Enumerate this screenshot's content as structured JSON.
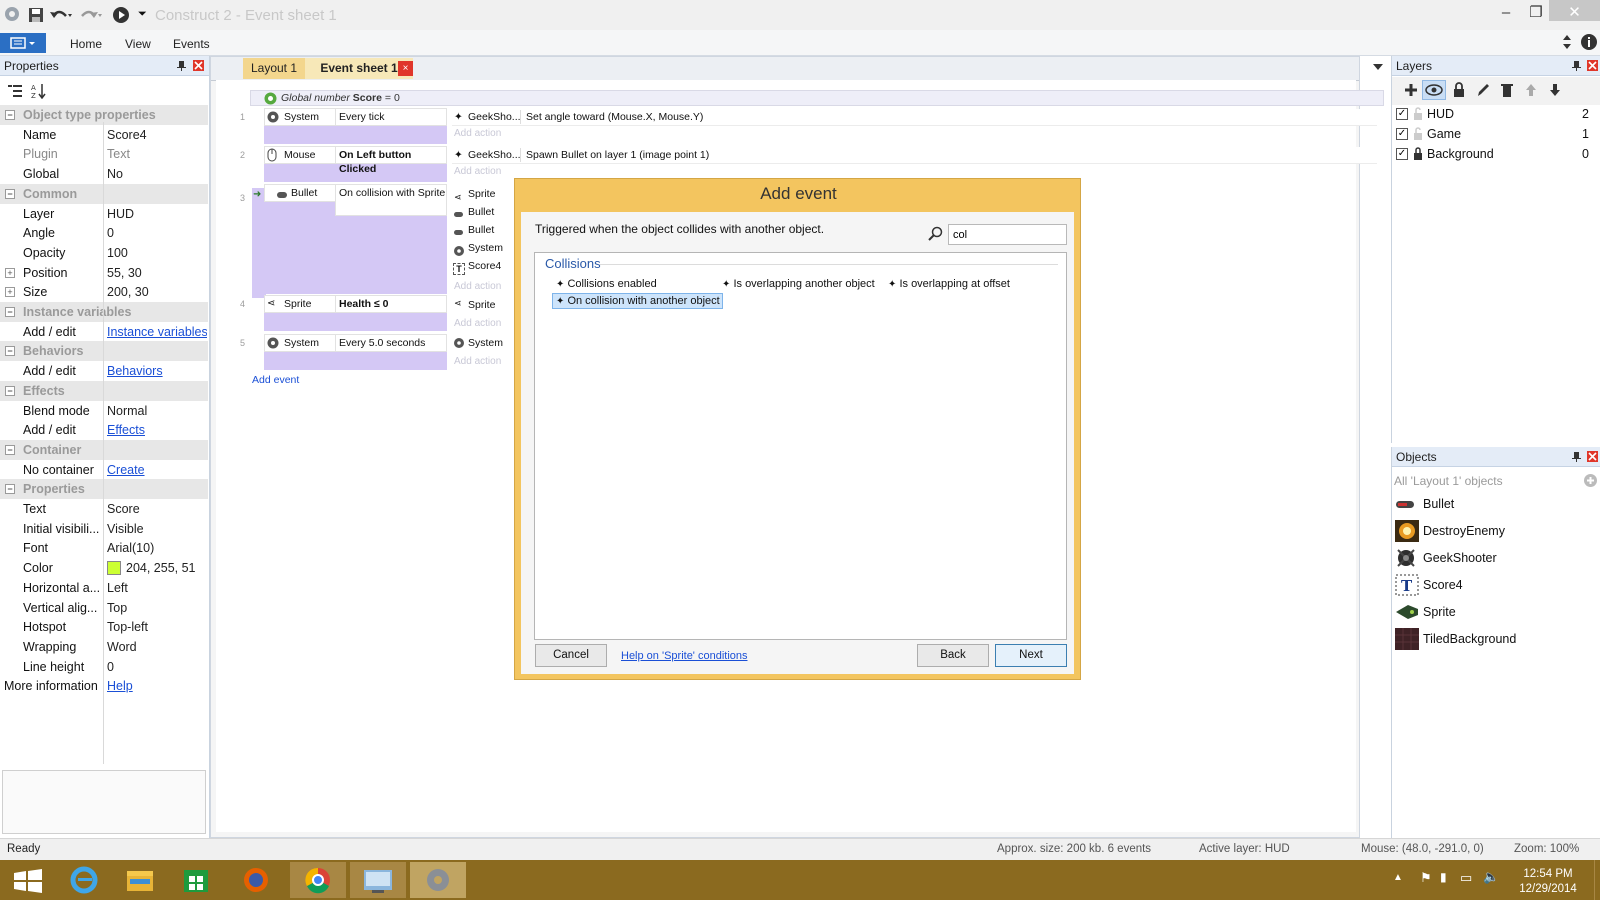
{
  "window": {
    "titlebar": {
      "title": "Construct 2 - Event sheet 1"
    },
    "ribbon_tabs": [
      "Home",
      "View",
      "Events"
    ]
  },
  "properties_panel": {
    "title": "Properties",
    "rows": [
      {
        "type": "section",
        "label": "Object type properties"
      },
      {
        "key": "Name",
        "value": "Score4"
      },
      {
        "key": "Plugin",
        "value": "Text",
        "muted": true
      },
      {
        "key": "Global",
        "value": "No"
      },
      {
        "type": "section",
        "label": "Common"
      },
      {
        "key": "Layer",
        "value": "HUD"
      },
      {
        "key": "Angle",
        "value": "0"
      },
      {
        "key": "Opacity",
        "value": "100"
      },
      {
        "key": "Position",
        "value": "55, 30",
        "expand": true
      },
      {
        "key": "Size",
        "value": "200, 30",
        "expand": true
      },
      {
        "type": "section",
        "label": "Instance variables"
      },
      {
        "key": "Add / edit",
        "link": "Instance variables"
      },
      {
        "type": "section",
        "label": "Behaviors"
      },
      {
        "key": "Add / edit",
        "link": "Behaviors"
      },
      {
        "type": "section",
        "label": "Effects"
      },
      {
        "key": "Blend mode",
        "value": "Normal"
      },
      {
        "key": "Add / edit",
        "link": "Effects"
      },
      {
        "type": "section",
        "label": "Container"
      },
      {
        "key": "No container",
        "link": "Create"
      },
      {
        "type": "section",
        "label": "Properties"
      },
      {
        "key": "Text",
        "value": "Score"
      },
      {
        "key": "Initial visibili...",
        "value": "Visible"
      },
      {
        "key": "Font",
        "value": "Arial(10)"
      },
      {
        "key": "Color",
        "value": "204, 255, 51",
        "swatch": "#ccff33"
      },
      {
        "key": "Horizontal a...",
        "value": "Left"
      },
      {
        "key": "Vertical alig...",
        "value": "Top"
      },
      {
        "key": "Hotspot",
        "value": "Top-left"
      },
      {
        "key": "Wrapping",
        "value": "Word"
      },
      {
        "key": "Line height",
        "value": "0"
      },
      {
        "key": "More information",
        "link": "Help",
        "wide": true
      }
    ]
  },
  "doc_tabs": [
    {
      "label": "Layout 1",
      "active": false
    },
    {
      "label": "Event sheet 1",
      "active": true
    }
  ],
  "event_sheet": {
    "global_var": {
      "prefix": "Global number ",
      "name": "Score",
      "suffix": " = 0"
    },
    "events": [
      {
        "num": "1",
        "object": "System",
        "condition": "Every tick",
        "actions": [
          {
            "object": "GeekSho...",
            "text": "Set angle toward (Mouse.X, Mouse.Y)"
          }
        ]
      },
      {
        "num": "2",
        "object": "Mouse",
        "condition": "On Left button Clicked",
        "actions": [
          {
            "object": "GeekSho...",
            "text": "Spawn  Bullet on layer 1 (image point 1)"
          }
        ]
      },
      {
        "num": "3",
        "object": "Bullet",
        "condition": "On collision with  Sprite",
        "actions": [
          {
            "object": "Sprite"
          },
          {
            "object": "Bullet"
          },
          {
            "object": "Bullet"
          },
          {
            "object": "System"
          },
          {
            "object": "Score4"
          }
        ]
      },
      {
        "num": "4",
        "object": "Sprite",
        "condition": "Health ≤ 0",
        "actions": [
          {
            "object": "Sprite"
          }
        ]
      },
      {
        "num": "5",
        "object": "System",
        "condition": "Every 5.0 seconds",
        "actions": [
          {
            "object": "System"
          }
        ]
      }
    ],
    "add_action": "Add action",
    "add_event": "Add event"
  },
  "dialog": {
    "title": "Add event",
    "description": "Triggered when the object collides with another object.",
    "search_value": "col",
    "group": "Collisions",
    "items": [
      {
        "label": "Collisions enabled",
        "selected": false
      },
      {
        "label": "Is overlapping another object",
        "selected": false
      },
      {
        "label": "Is overlapping at offset",
        "selected": false
      },
      {
        "label": "On collision with another object",
        "selected": true
      }
    ],
    "cancel": "Cancel",
    "help_link": "Help on 'Sprite' conditions",
    "back": "Back",
    "next": "Next"
  },
  "layers_panel": {
    "title": "Layers",
    "layers": [
      {
        "name": "HUD",
        "index": "2",
        "locked": false
      },
      {
        "name": "Game",
        "index": "1",
        "locked": false
      },
      {
        "name": "Background",
        "index": "0",
        "locked": true
      }
    ]
  },
  "objects_panel": {
    "title": "Objects",
    "filter": "All 'Layout 1' objects",
    "objects": [
      {
        "name": "Bullet",
        "icon": "bullet-icon"
      },
      {
        "name": "DestroyEnemy",
        "icon": "explosion-icon"
      },
      {
        "name": "GeekShooter",
        "icon": "shooter-icon"
      },
      {
        "name": "Score4",
        "icon": "text-icon"
      },
      {
        "name": "Sprite",
        "icon": "sprite-icon"
      },
      {
        "name": "TiledBackground",
        "icon": "tiled-background-icon"
      }
    ]
  },
  "statusbar": {
    "status": "Ready",
    "size": "Approx. size: 200 kb. 6 events",
    "active_layer": "Active layer: HUD",
    "mouse": "Mouse: (48.0, -291.0, 0)",
    "zoom": "Zoom: 100%"
  },
  "taskbar": {
    "time": "12:54 PM",
    "date": "12/29/2014"
  },
  "colors": {
    "accent": "#2b6fc4",
    "dialog": "#f3c55f",
    "condition": "#d4c8f5",
    "taskbar": "#8b6a1f"
  }
}
